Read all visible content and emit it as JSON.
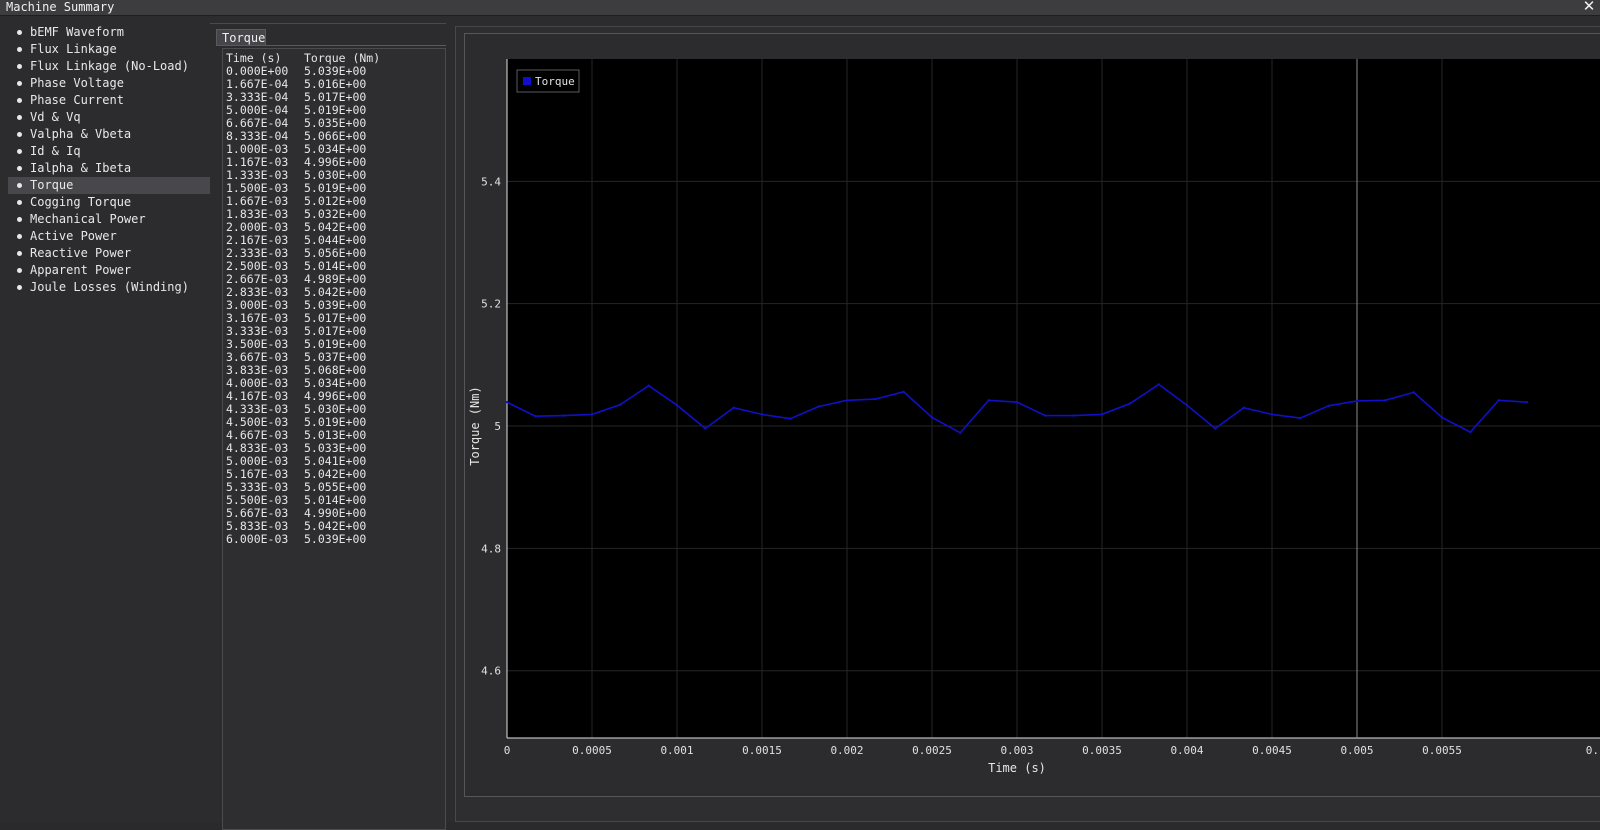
{
  "window": {
    "title": "Machine Summary",
    "close_glyph": "✕"
  },
  "sidebar": {
    "selected_index": 9,
    "items": [
      {
        "label": "bEMF Waveform"
      },
      {
        "label": "Flux Linkage"
      },
      {
        "label": "Flux Linkage (No-Load)"
      },
      {
        "label": "Phase Voltage"
      },
      {
        "label": "Phase Current"
      },
      {
        "label": "Vd & Vq"
      },
      {
        "label": "Valpha & Vbeta"
      },
      {
        "label": "Id & Iq"
      },
      {
        "label": "Ialpha & Ibeta"
      },
      {
        "label": "Torque"
      },
      {
        "label": "Cogging Torque"
      },
      {
        "label": "Mechanical Power"
      },
      {
        "label": "Active Power"
      },
      {
        "label": "Reactive Power"
      },
      {
        "label": "Apparent Power"
      },
      {
        "label": "Joule Losses (Winding)"
      }
    ]
  },
  "table": {
    "tab_label": "Torque",
    "headers": [
      "Time (s)",
      "Torque (Nm)"
    ],
    "rows": [
      [
        "0.000E+00",
        "5.039E+00"
      ],
      [
        "1.667E-04",
        "5.016E+00"
      ],
      [
        "3.333E-04",
        "5.017E+00"
      ],
      [
        "5.000E-04",
        "5.019E+00"
      ],
      [
        "6.667E-04",
        "5.035E+00"
      ],
      [
        "8.333E-04",
        "5.066E+00"
      ],
      [
        "1.000E-03",
        "5.034E+00"
      ],
      [
        "1.167E-03",
        "4.996E+00"
      ],
      [
        "1.333E-03",
        "5.030E+00"
      ],
      [
        "1.500E-03",
        "5.019E+00"
      ],
      [
        "1.667E-03",
        "5.012E+00"
      ],
      [
        "1.833E-03",
        "5.032E+00"
      ],
      [
        "2.000E-03",
        "5.042E+00"
      ],
      [
        "2.167E-03",
        "5.044E+00"
      ],
      [
        "2.333E-03",
        "5.056E+00"
      ],
      [
        "2.500E-03",
        "5.014E+00"
      ],
      [
        "2.667E-03",
        "4.989E+00"
      ],
      [
        "2.833E-03",
        "5.042E+00"
      ],
      [
        "3.000E-03",
        "5.039E+00"
      ],
      [
        "3.167E-03",
        "5.017E+00"
      ],
      [
        "3.333E-03",
        "5.017E+00"
      ],
      [
        "3.500E-03",
        "5.019E+00"
      ],
      [
        "3.667E-03",
        "5.037E+00"
      ],
      [
        "3.833E-03",
        "5.068E+00"
      ],
      [
        "4.000E-03",
        "5.034E+00"
      ],
      [
        "4.167E-03",
        "4.996E+00"
      ],
      [
        "4.333E-03",
        "5.030E+00"
      ],
      [
        "4.500E-03",
        "5.019E+00"
      ],
      [
        "4.667E-03",
        "5.013E+00"
      ],
      [
        "4.833E-03",
        "5.033E+00"
      ],
      [
        "5.000E-03",
        "5.041E+00"
      ],
      [
        "5.167E-03",
        "5.042E+00"
      ],
      [
        "5.333E-03",
        "5.055E+00"
      ],
      [
        "5.500E-03",
        "5.014E+00"
      ],
      [
        "5.667E-03",
        "4.990E+00"
      ],
      [
        "5.833E-03",
        "5.042E+00"
      ],
      [
        "6.000E-03",
        "5.039E+00"
      ]
    ]
  },
  "chart_data": {
    "type": "line",
    "title": "",
    "xlabel": "Time (s)",
    "ylabel": "Torque (Nm)",
    "xlim": [
      0,
      0.006
    ],
    "ylim": [
      4.49,
      5.6
    ],
    "x_ticks": [
      0,
      0.0005,
      0.001,
      0.0015,
      0.002,
      0.0025,
      0.003,
      0.0035,
      0.004,
      0.0045,
      0.005,
      0.0055
    ],
    "x_tick_labels": [
      "0",
      "0.0005",
      "0.001",
      "0.0015",
      "0.002",
      "0.0025",
      "0.003",
      "0.0035",
      "0.004",
      "0.0045",
      "0.005",
      "0.0055",
      "0."
    ],
    "y_ticks": [
      4.6,
      4.8,
      5.0,
      5.2,
      5.4
    ],
    "y_tick_labels": [
      "4.6",
      "4.8",
      "5",
      "5.2",
      "5.4"
    ],
    "grid": true,
    "legend_position": "top-left",
    "plot_background": "#000000",
    "series": [
      {
        "name": "Torque",
        "color": "#1010c8",
        "x": [
          0,
          0.0001667,
          0.0003333,
          0.0005,
          0.0006667,
          0.0008333,
          0.001,
          0.0011667,
          0.0013333,
          0.0015,
          0.0016667,
          0.0018333,
          0.002,
          0.0021667,
          0.0023333,
          0.0025,
          0.0026667,
          0.0028333,
          0.003,
          0.0031667,
          0.0033333,
          0.0035,
          0.0036667,
          0.0038333,
          0.004,
          0.0041667,
          0.0043333,
          0.0045,
          0.0046667,
          0.0048333,
          0.005,
          0.0051667,
          0.0053333,
          0.0055,
          0.0056667,
          0.0058333,
          0.006
        ],
        "y": [
          5.039,
          5.016,
          5.017,
          5.019,
          5.035,
          5.066,
          5.034,
          4.996,
          5.03,
          5.019,
          5.012,
          5.032,
          5.042,
          5.044,
          5.056,
          5.014,
          4.989,
          5.042,
          5.039,
          5.017,
          5.017,
          5.019,
          5.037,
          5.068,
          5.034,
          4.996,
          5.03,
          5.019,
          5.013,
          5.033,
          5.041,
          5.042,
          5.055,
          5.014,
          4.99,
          5.042,
          5.039
        ]
      }
    ],
    "cursor_x": 0.005
  }
}
